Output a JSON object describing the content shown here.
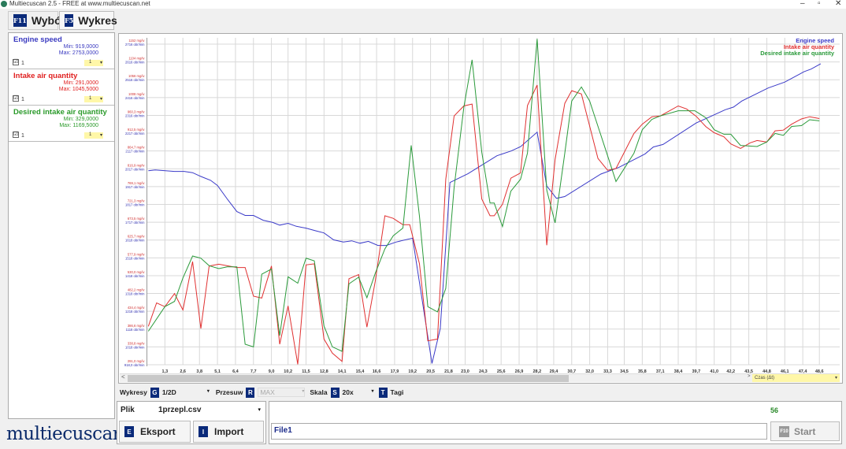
{
  "window": {
    "title": "Multiecuscan 2.5 - FREE at www.multiecuscan.net",
    "minimize": "–",
    "maximize": "▫",
    "close": "✕"
  },
  "tabs": [
    {
      "key": "F11",
      "label": "Wybór"
    },
    {
      "key": "F5",
      "label": "Wykres"
    }
  ],
  "signals": [
    {
      "name": "Engine speed",
      "min": "Min: 919,0000",
      "max": "Max: 2753,0000",
      "check": "☑",
      "index": "1",
      "select": "1",
      "color": "#3a3ac0"
    },
    {
      "name": "Intake air quantity",
      "min": "Min: 291,0000",
      "max": "Max: 1045,5000",
      "check": "☑",
      "index": "1",
      "select": "1",
      "color": "#e02020"
    },
    {
      "name": "Desired intake air quantity",
      "min": "Min: 329,0000",
      "max": "Max: 1169,5000",
      "check": "☑",
      "index": "1",
      "select": "1",
      "color": "#2a9a2a"
    }
  ],
  "logo": "multiecuscan",
  "scroll": {
    "left_arrow": "<",
    "right_arrow": ">",
    "axis_select": "Czas (Δt)"
  },
  "toolbar": {
    "charts_label": "Wykresy",
    "charts_key": "G",
    "charts_value": "1/2D",
    "shift_label": "Przesuw",
    "shift_key": "R",
    "shift_value": "MAX",
    "scale_label": "Skala",
    "scale_key": "S",
    "scale_value": "20x",
    "tags_key": "T",
    "tags_label": "Tagi",
    "dropdown_arrow": "▾"
  },
  "file": {
    "label": "Plik",
    "value": "1przepl.csv",
    "export_key": "E",
    "export_label": "Eksport",
    "import_key": "I",
    "import_label": "Import"
  },
  "recording": {
    "count": "56",
    "name": "File1",
    "start_key": "F10",
    "start_label": "Start"
  },
  "chart_data": {
    "type": "line",
    "xlabel": "Czas (Δt)",
    "x_ticks": [
      "1,3",
      "2,6",
      "3,8",
      "5,1",
      "6,4",
      "7,7",
      "9,0",
      "10,2",
      "11,5",
      "12,8",
      "14,1",
      "15,4",
      "16,6",
      "17,9",
      "19,2",
      "20,5",
      "21,8",
      "23,0",
      "24,3",
      "25,6",
      "26,9",
      "28,2",
      "29,4",
      "30,7",
      "32,0",
      "33,3",
      "34,5",
      "35,8",
      "37,1",
      "38,4",
      "39,7",
      "41,0",
      "42,2",
      "43,5",
      "44,8",
      "46,1",
      "47,4",
      "48,6"
    ],
    "xlim": [
      0,
      49.5
    ],
    "y_ticks_mg": [
      "291,0 mg/iv",
      "338,8 mg/iv",
      "386,6 mg/iv",
      "434,4 mg/iv",
      "482,2 mg/iv",
      "530,0 mg/iv",
      "577,9 mg/iv",
      "625,7 mg/iv",
      "673,5 mg/iv",
      "721,3 mg/iv",
      "769,1 mg/iv",
      "816,9 mg/iv",
      "864,7 mg/iv",
      "912,5 mg/iv",
      "960,3 mg/iv",
      "1008 mg/iv",
      "1056 mg/iv",
      "1104 mg/iv",
      "1152 mg/iv"
    ],
    "y_ticks_rpm": [
      "918,0 obr/min",
      "1018 obr/min",
      "1118 obr/min",
      "1218 obr/min",
      "1318 obr/min",
      "1418 obr/min",
      "1518 obr/min",
      "1618 obr/min",
      "1717 obr/min",
      "1817 obr/min",
      "1917 obr/min",
      "2017 obr/min",
      "2117 obr/min",
      "2217 obr/min",
      "2316 obr/min",
      "2416 obr/min",
      "2516 obr/min",
      "2616 obr/min",
      "2716 obr/min"
    ],
    "ylim_mg": [
      291,
      1152
    ],
    "ylim_rpm": [
      918,
      2716
    ],
    "grid": true,
    "legend_position": "top-right",
    "series": [
      {
        "name": "Engine speed",
        "axis": "rpm",
        "color": "#3a3ac8",
        "points": [
          [
            0.1,
            2006
          ],
          [
            0.6,
            2010
          ],
          [
            2.0,
            2002
          ],
          [
            2.7,
            2002
          ],
          [
            3.3,
            1995
          ],
          [
            3.9,
            1974
          ],
          [
            4.6,
            1952
          ],
          [
            5.1,
            1923
          ],
          [
            5.8,
            1848
          ],
          [
            6.5,
            1777
          ],
          [
            7.1,
            1755
          ],
          [
            7.7,
            1755
          ],
          [
            8.4,
            1728
          ],
          [
            9.1,
            1716
          ],
          [
            9.6,
            1701
          ],
          [
            10.2,
            1711
          ],
          [
            10.8,
            1694
          ],
          [
            11.5,
            1684
          ],
          [
            12.2,
            1669
          ],
          [
            12.8,
            1657
          ],
          [
            13.5,
            1618
          ],
          [
            14.2,
            1606
          ],
          [
            14.8,
            1613
          ],
          [
            15.4,
            1599
          ],
          [
            16.0,
            1610
          ],
          [
            16.7,
            1587
          ],
          [
            17.3,
            1587
          ],
          [
            18.0,
            1606
          ],
          [
            19.2,
            1628
          ],
          [
            20.6,
            925
          ],
          [
            21.2,
            1120
          ],
          [
            21.9,
            1940
          ],
          [
            23.2,
            1989
          ],
          [
            25.3,
            2090
          ],
          [
            26.3,
            2116
          ],
          [
            27.0,
            2141
          ],
          [
            28.2,
            2222
          ],
          [
            28.9,
            1921
          ],
          [
            29.6,
            1851
          ],
          [
            30.2,
            1861
          ],
          [
            32.8,
            1987
          ],
          [
            34.1,
            2024
          ],
          [
            36.0,
            2100
          ],
          [
            36.6,
            2139
          ],
          [
            37.3,
            2153
          ],
          [
            39.7,
            2274
          ],
          [
            41.8,
            2348
          ],
          [
            42.4,
            2363
          ],
          [
            43.0,
            2397
          ],
          [
            44.9,
            2470
          ],
          [
            46.1,
            2503
          ],
          [
            47.5,
            2562
          ],
          [
            48.0,
            2576
          ],
          [
            48.7,
            2606
          ]
        ]
      },
      {
        "name": "Intake air quantity",
        "axis": "mg",
        "color": "#e03030",
        "points": [
          [
            0.1,
            394
          ],
          [
            0.7,
            457
          ],
          [
            1.3,
            447
          ],
          [
            2.0,
            482
          ],
          [
            2.6,
            438
          ],
          [
            3.3,
            568
          ],
          [
            3.9,
            388
          ],
          [
            4.5,
            556
          ],
          [
            5.2,
            561
          ],
          [
            6.5,
            552
          ],
          [
            7.1,
            552
          ],
          [
            7.7,
            475
          ],
          [
            8.3,
            470
          ],
          [
            9.0,
            556
          ],
          [
            9.6,
            346
          ],
          [
            10.2,
            449
          ],
          [
            10.9,
            292
          ],
          [
            11.5,
            559
          ],
          [
            12.1,
            562
          ],
          [
            12.8,
            360
          ],
          [
            13.4,
            322
          ],
          [
            14.1,
            300
          ],
          [
            14.6,
            522
          ],
          [
            15.3,
            533
          ],
          [
            15.9,
            392
          ],
          [
            16.5,
            514
          ],
          [
            17.2,
            691
          ],
          [
            17.8,
            684
          ],
          [
            18.5,
            667
          ],
          [
            19.0,
            667
          ],
          [
            19.7,
            562
          ],
          [
            20.3,
            355
          ],
          [
            21.0,
            360
          ],
          [
            21.6,
            789
          ],
          [
            22.2,
            959
          ],
          [
            22.9,
            986
          ],
          [
            23.5,
            991
          ],
          [
            24.2,
            736
          ],
          [
            24.8,
            691
          ],
          [
            25.1,
            691
          ],
          [
            25.7,
            722
          ],
          [
            26.3,
            792
          ],
          [
            27.0,
            806
          ],
          [
            27.5,
            987
          ],
          [
            28.2,
            1042
          ],
          [
            28.9,
            612
          ],
          [
            29.5,
            842
          ],
          [
            30.2,
            993
          ],
          [
            30.7,
            1027
          ],
          [
            31.4,
            1018
          ],
          [
            32.6,
            845
          ],
          [
            33.3,
            813
          ],
          [
            33.9,
            818
          ],
          [
            35.2,
            912
          ],
          [
            35.8,
            937
          ],
          [
            36.5,
            957
          ],
          [
            37.1,
            959
          ],
          [
            38.4,
            986
          ],
          [
            39.0,
            978
          ],
          [
            39.7,
            958
          ],
          [
            40.4,
            930
          ],
          [
            41.0,
            914
          ],
          [
            41.7,
            903
          ],
          [
            42.2,
            884
          ],
          [
            42.9,
            872
          ],
          [
            43.6,
            887
          ],
          [
            44.1,
            893
          ],
          [
            44.8,
            889
          ],
          [
            45.4,
            919
          ],
          [
            46.0,
            921
          ],
          [
            46.6,
            937
          ],
          [
            47.3,
            951
          ],
          [
            47.9,
            957
          ],
          [
            48.6,
            952
          ]
        ]
      },
      {
        "name": "Desired intake air quantity",
        "axis": "mg",
        "color": "#2a9a3a",
        "points": [
          [
            0.1,
            381
          ],
          [
            1.3,
            447
          ],
          [
            2.0,
            461
          ],
          [
            2.6,
            524
          ],
          [
            3.3,
            583
          ],
          [
            3.9,
            577
          ],
          [
            4.5,
            557
          ],
          [
            5.2,
            549
          ],
          [
            5.8,
            554
          ],
          [
            6.5,
            554
          ],
          [
            7.1,
            346
          ],
          [
            7.7,
            339
          ],
          [
            8.3,
            534
          ],
          [
            9.0,
            548
          ],
          [
            9.6,
            369
          ],
          [
            10.2,
            527
          ],
          [
            10.9,
            510
          ],
          [
            11.5,
            577
          ],
          [
            12.1,
            570
          ],
          [
            12.8,
            395
          ],
          [
            13.4,
            339
          ],
          [
            14.1,
            327
          ],
          [
            14.6,
            508
          ],
          [
            15.3,
            526
          ],
          [
            15.9,
            471
          ],
          [
            16.5,
            536
          ],
          [
            17.2,
            602
          ],
          [
            17.8,
            637
          ],
          [
            18.5,
            658
          ],
          [
            19.1,
            880
          ],
          [
            19.7,
            690
          ],
          [
            20.3,
            447
          ],
          [
            21.0,
            433
          ],
          [
            21.6,
            496
          ],
          [
            22.2,
            767
          ],
          [
            22.9,
            982
          ],
          [
            23.5,
            1110
          ],
          [
            24.2,
            862
          ],
          [
            24.8,
            725
          ],
          [
            25.1,
            725
          ],
          [
            25.7,
            662
          ],
          [
            26.3,
            757
          ],
          [
            27.0,
            789
          ],
          [
            27.5,
            859
          ],
          [
            28.2,
            1166
          ],
          [
            28.9,
            760
          ],
          [
            29.5,
            672
          ],
          [
            30.2,
            859
          ],
          [
            30.7,
            999
          ],
          [
            31.4,
            1037
          ],
          [
            32.0,
            999
          ],
          [
            33.3,
            852
          ],
          [
            33.9,
            783
          ],
          [
            35.2,
            859
          ],
          [
            35.8,
            922
          ],
          [
            36.5,
            950
          ],
          [
            37.1,
            959
          ],
          [
            38.4,
            973
          ],
          [
            39.6,
            973
          ],
          [
            40.4,
            954
          ],
          [
            41.0,
            922
          ],
          [
            41.7,
            910
          ],
          [
            42.2,
            910
          ],
          [
            42.9,
            880
          ],
          [
            44.1,
            877
          ],
          [
            44.8,
            889
          ],
          [
            45.4,
            912
          ],
          [
            46.0,
            907
          ],
          [
            46.6,
            931
          ],
          [
            47.3,
            933
          ],
          [
            47.9,
            949
          ],
          [
            48.6,
            946
          ]
        ]
      }
    ]
  }
}
